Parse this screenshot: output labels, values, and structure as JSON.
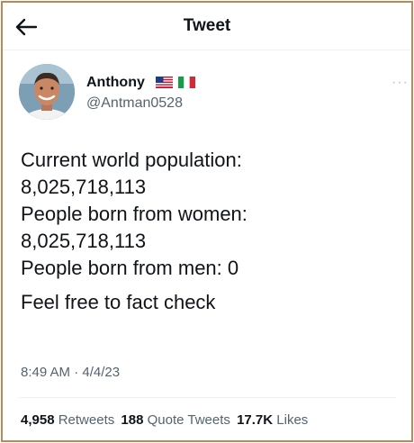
{
  "header": {
    "title": "Tweet",
    "back_icon": "arrow-left-icon"
  },
  "author": {
    "display_name": "Anthony",
    "handle": "@Antman0528",
    "flags": [
      "us-flag-icon",
      "italy-flag-icon"
    ],
    "avatar": "avatar-photo"
  },
  "more_icon": "more-horizontal-icon",
  "tweet": {
    "lines": [
      "Current world population:",
      "8,025,718,113",
      "People born from women:",
      "8,025,718,113",
      "People born from men: 0",
      "Feel free to fact check"
    ],
    "timestamp": "8:49 AM · 4/4/23"
  },
  "stats": {
    "retweets_count": "4,958",
    "retweets_label": "Retweets",
    "quotes_count": "188",
    "quotes_label": "Quote Tweets",
    "likes_count": "17.7K",
    "likes_label": "Likes"
  },
  "colors": {
    "frame_border": "#b9895c",
    "primary_text": "#0f1419",
    "secondary_text": "#536471",
    "divider": "#eff3f4"
  }
}
